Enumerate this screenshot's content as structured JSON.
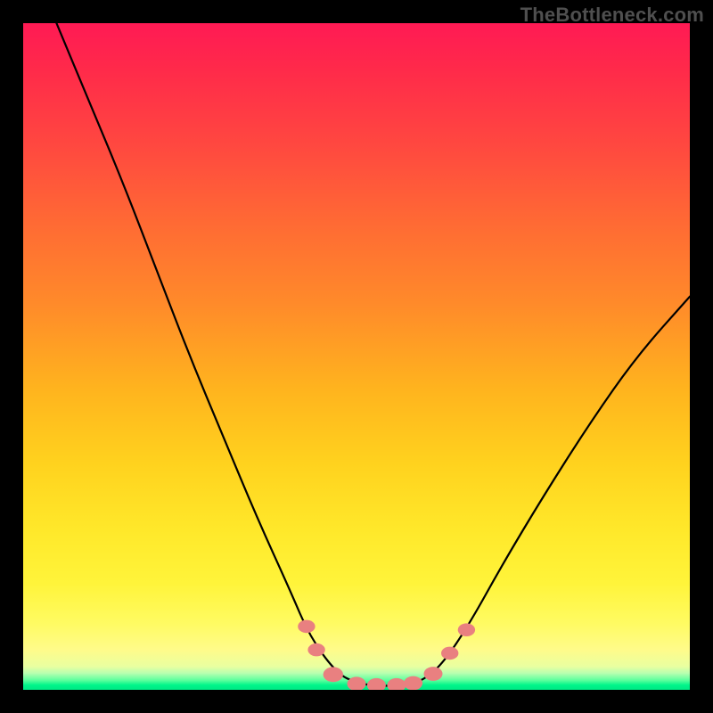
{
  "watermark": "TheBottleneck.com",
  "colors": {
    "bead": "#e98080",
    "curve": "#000000"
  },
  "chart_data": {
    "type": "line",
    "title": "",
    "xlabel": "",
    "ylabel": "",
    "xlim": [
      0,
      100
    ],
    "ylim": [
      0,
      100
    ],
    "grid": false,
    "legend": false,
    "annotations": [
      "TheBottleneck.com"
    ],
    "series": [
      {
        "name": "bottleneck-curve",
        "x": [
          5,
          10,
          15,
          20,
          25,
          30,
          35,
          40,
          43,
          47,
          50,
          53,
          57,
          60,
          63,
          67,
          72,
          78,
          85,
          92,
          100
        ],
        "y": [
          100,
          88,
          76,
          63,
          50,
          38,
          26,
          15,
          8,
          2.5,
          1,
          0.6,
          0.6,
          1.4,
          4,
          10,
          19,
          29,
          40,
          50,
          59
        ]
      }
    ],
    "markers": [
      {
        "name": "bead-left-upper",
        "x": 42.5,
        "y": 9.5,
        "size": 1.3
      },
      {
        "name": "bead-left-mid",
        "x": 44.0,
        "y": 6.0,
        "size": 1.3
      },
      {
        "name": "bead-left-lower",
        "x": 46.5,
        "y": 2.3,
        "size": 1.5
      },
      {
        "name": "bead-bottom-a",
        "x": 50.0,
        "y": 0.9,
        "size": 1.4
      },
      {
        "name": "bead-bottom-b",
        "x": 53.0,
        "y": 0.7,
        "size": 1.4
      },
      {
        "name": "bead-bottom-c",
        "x": 56.0,
        "y": 0.7,
        "size": 1.4
      },
      {
        "name": "bead-bottom-d",
        "x": 58.5,
        "y": 1.0,
        "size": 1.4
      },
      {
        "name": "bead-right-lower",
        "x": 61.5,
        "y": 2.4,
        "size": 1.4
      },
      {
        "name": "bead-right-mid",
        "x": 64.0,
        "y": 5.5,
        "size": 1.3
      },
      {
        "name": "bead-right-upper",
        "x": 66.5,
        "y": 9.0,
        "size": 1.3
      }
    ]
  }
}
